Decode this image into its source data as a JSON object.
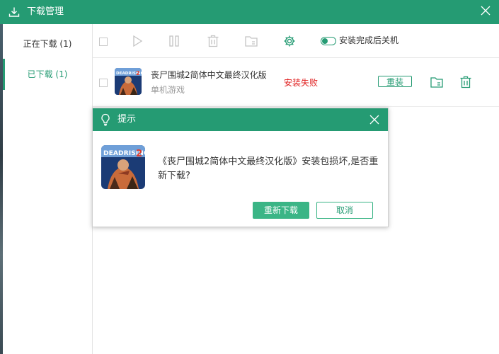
{
  "window": {
    "title": "下载管理",
    "icon": "download-icon",
    "accent_color": "#259b73"
  },
  "sidebar": {
    "items": [
      {
        "label": "正在下载 (1)",
        "active": false
      },
      {
        "label": "已下载 (1)",
        "active": true
      }
    ]
  },
  "toolbar": {
    "icons": [
      "checkbox",
      "play-icon",
      "pause-icon",
      "trash-icon",
      "folder-icon",
      "gear-icon"
    ],
    "shutdown_label": "安装完成后关机",
    "shutdown_enabled": false
  },
  "downloads": [
    {
      "name": "丧尸围城2简体中文最终汉化版",
      "category": "单机游戏",
      "status": "安装失败",
      "status_color": "#e02020",
      "action_label": "重装",
      "cover_text": "DEADRISING 2"
    }
  ],
  "dialog": {
    "title": "提示",
    "message": "《丧尸围城2简体中文最终汉化版》安装包损坏,是否重新下载?",
    "primary_label": "重新下载",
    "secondary_label": "取消"
  }
}
